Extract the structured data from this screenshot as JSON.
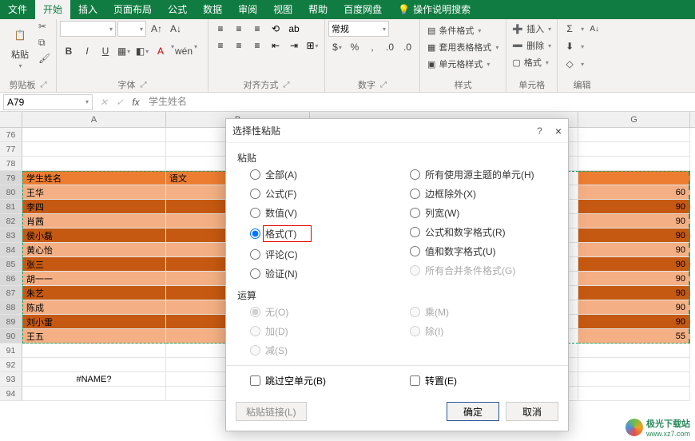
{
  "tabs": {
    "file": "文件",
    "home": "开始",
    "insert": "插入",
    "layout": "页面布局",
    "formula": "公式",
    "data": "数据",
    "review": "审阅",
    "view": "视图",
    "help": "帮助",
    "netdisk": "百度网盘",
    "tellme": "操作说明搜索"
  },
  "ribbon": {
    "clipboard": {
      "paste": "粘贴",
      "label": "剪贴板"
    },
    "font": {
      "label": "字体",
      "bold": "B",
      "italic": "I",
      "underline": "U",
      "wen": "wén",
      "fontA": "A",
      "fontA2": "A"
    },
    "align": {
      "label": "对齐方式",
      "wrap": "ab"
    },
    "number": {
      "label": "数字",
      "general": "常规"
    },
    "styles": {
      "label": "样式",
      "cond": "条件格式",
      "table": "套用表格格式",
      "cell": "单元格样式"
    },
    "cells": {
      "label": "单元格",
      "insert": "插入",
      "delete": "删除",
      "format": "格式"
    },
    "editing": {
      "label": "编辑",
      "sigma": "Σ",
      "az": "A"
    }
  },
  "namebox": "A79",
  "formula_text": "学生姓名",
  "fx": "fx",
  "cols": [
    "A",
    "B",
    "G"
  ],
  "sheet": {
    "head": {
      "a": "学生姓名",
      "b": "语文"
    },
    "rows": [
      {
        "n": 76,
        "a": "",
        "g": ""
      },
      {
        "n": 77,
        "a": "",
        "g": ""
      },
      {
        "n": 78,
        "a": "",
        "g": ""
      },
      {
        "n": 79,
        "a": "学生姓名",
        "b": "语文",
        "g": ""
      },
      {
        "n": 80,
        "a": "王华",
        "g": "60"
      },
      {
        "n": 81,
        "a": "李四",
        "g": "90"
      },
      {
        "n": 82,
        "a": "肖茜",
        "g": "90"
      },
      {
        "n": 83,
        "a": "侯小磊",
        "g": "90"
      },
      {
        "n": 84,
        "a": "黄心怡",
        "g": "90"
      },
      {
        "n": 85,
        "a": "张三",
        "g": "90"
      },
      {
        "n": 86,
        "a": "胡一一",
        "g": "90"
      },
      {
        "n": 87,
        "a": "朱艺",
        "g": "90"
      },
      {
        "n": 88,
        "a": "陈成",
        "g": "90"
      },
      {
        "n": 89,
        "a": "刘小雷",
        "g": "90"
      },
      {
        "n": 90,
        "a": "王五",
        "g": "55"
      }
    ],
    "extra_rows": [
      "91",
      "92",
      "93",
      "94"
    ],
    "name_err": "#NAME?"
  },
  "dialog": {
    "title": "选择性粘贴",
    "section_paste": "粘贴",
    "section_op": "运算",
    "left": {
      "all": "全部(A)",
      "formula": "公式(F)",
      "value": "数值(V)",
      "format": "格式(T)",
      "comment": "评论(C)",
      "validate": "验证(N)"
    },
    "right": {
      "theme": "所有使用源主题的单元(H)",
      "noborder": "边框除外(X)",
      "colw": "列宽(W)",
      "fn_num": "公式和数字格式(R)",
      "val_num": "值和数字格式(U)",
      "cond": "所有合并条件格式(G)"
    },
    "ops": {
      "none": "无(O)",
      "add": "加(D)",
      "sub": "减(S)",
      "mul": "乘(M)",
      "div": "除(I)"
    },
    "skip_blank": "跳过空单元(B)",
    "transpose": "转置(E)",
    "paste_link": "粘贴链接(L)",
    "ok": "确定",
    "cancel": "取消",
    "help": "?",
    "close": "×"
  },
  "watermark": {
    "text": "极光下载站",
    "url": "www.xz7.com"
  }
}
